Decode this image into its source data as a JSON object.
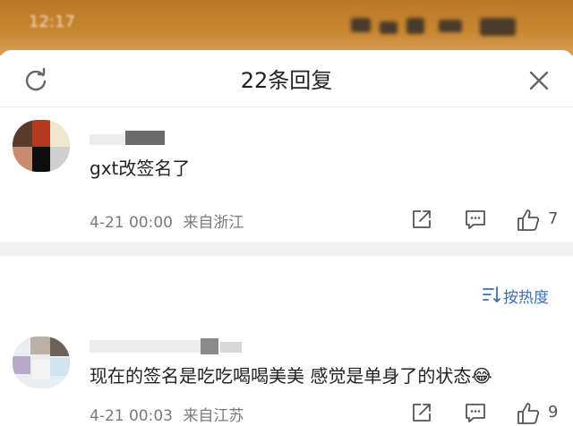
{
  "status_bar": {
    "time": "12:17"
  },
  "sheet": {
    "title": "22条回复"
  },
  "comments": [
    {
      "text": "gxt改签名了",
      "date": "4-21 00:00",
      "location": "来自浙江",
      "like_count": "7"
    },
    {
      "text": "现在的签名是吃吃喝喝美美 感觉是单身了的状态😂",
      "date": "4-21 00:03",
      "location": "来自江苏",
      "like_count": "9"
    }
  ],
  "sort": {
    "label": "按热度"
  },
  "colors": {
    "accent": "#3a6fb0",
    "status_bar": "#c9862f",
    "divider": "#f2f2f2"
  },
  "icons": [
    "refresh-icon",
    "close-icon",
    "share-icon",
    "comment-icon",
    "like-icon",
    "sort-icon"
  ]
}
